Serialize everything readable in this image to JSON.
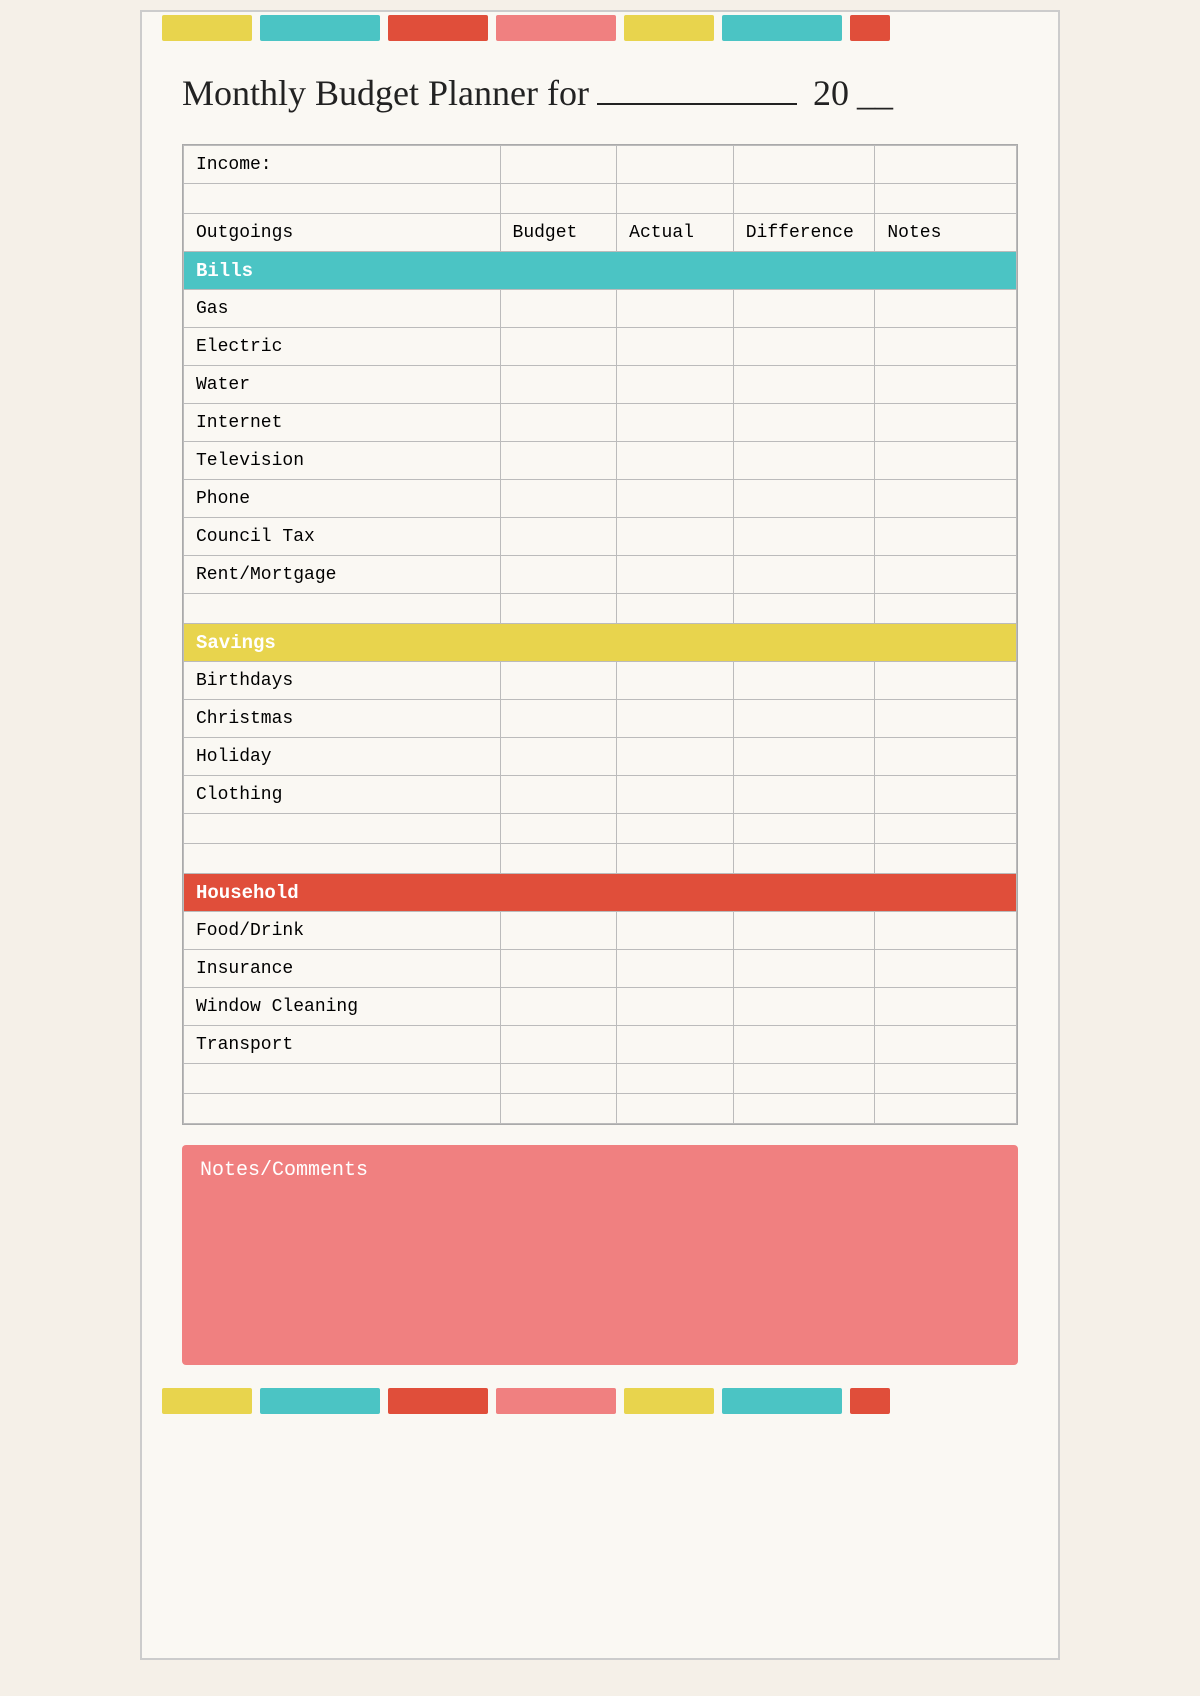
{
  "title": "Monthly Budget Planner for",
  "year_prefix": "20",
  "year_blank": "__",
  "colors": {
    "yellow": "#e8d44d",
    "teal": "#4bc4c4",
    "red": "#e04e3a",
    "pink": "#f08080",
    "light_yellow": "#f5e642"
  },
  "top_bar": [
    "#e8d44d",
    "#4bc4c4",
    "#e04e3a",
    "#f08080",
    "#e8d44d",
    "#4bc4c4",
    "#e04e3a"
  ],
  "bottom_bar": [
    "#e8d44d",
    "#4bc4c4",
    "#e04e3a",
    "#f08080",
    "#e8d44d",
    "#4bc4c4",
    "#e04e3a"
  ],
  "income_label": "Income:",
  "headers": {
    "outgoings": "Outgoings",
    "budget": "Budget",
    "actual": "Actual",
    "difference": "Difference",
    "notes": "Notes"
  },
  "sections": [
    {
      "name": "Bills",
      "color": "#4bc4c4",
      "items": [
        "Gas",
        "Electric",
        "Water",
        "Internet",
        "Television",
        "Phone",
        "Council Tax",
        "Rent/Mortgage",
        ""
      ]
    },
    {
      "name": "Savings",
      "color": "#e8d44d",
      "items": [
        "Birthdays",
        "Christmas",
        "Holiday",
        "Clothing",
        "",
        ""
      ]
    },
    {
      "name": "Household",
      "color": "#e04e3a",
      "items": [
        "Food/Drink",
        "Insurance",
        "Window Cleaning",
        "Transport",
        "",
        ""
      ]
    }
  ],
  "notes_section": {
    "title": "Notes/Comments",
    "color": "#f08080"
  }
}
